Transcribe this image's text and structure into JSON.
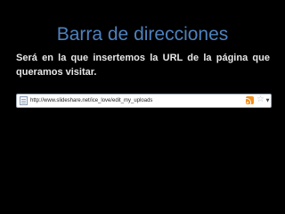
{
  "slide": {
    "title": "Barra de direcciones",
    "body": "Será en la que insertemos la URL de la página que queramos visitar."
  },
  "address_bar": {
    "url": "http://www.slideshare.net/ice_love/edit_my_uploads",
    "icons": {
      "page": "page-icon",
      "feed": "rss-feed-icon",
      "bookmark": "star-icon",
      "history": "chevron-down-icon"
    }
  },
  "colors": {
    "background": "#000000",
    "title": "#4f81bd",
    "body_text": "#e8e8e8",
    "feed_icon": "#f4901e"
  }
}
